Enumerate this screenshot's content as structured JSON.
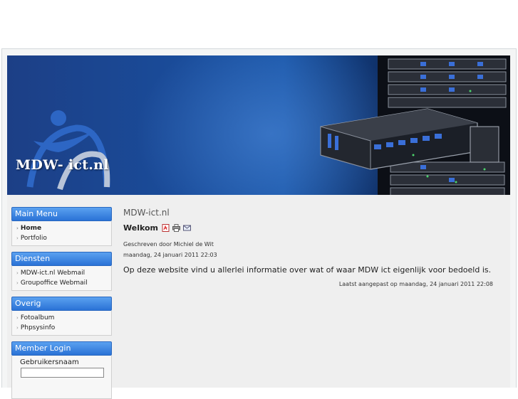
{
  "header": {
    "logo_text": "MDW- ict.nl"
  },
  "sidebar": {
    "main_menu": {
      "title": "Main Menu",
      "items": [
        {
          "label": "Home",
          "active": true
        },
        {
          "label": "Portfolio",
          "active": false
        }
      ]
    },
    "diensten": {
      "title": "Diensten",
      "items": [
        {
          "label": "MDW-ict.nl Webmail"
        },
        {
          "label": "Groupoffice Webmail"
        }
      ]
    },
    "overig": {
      "title": "Overig",
      "items": [
        {
          "label": "Fotoalbum"
        },
        {
          "label": "Phpsysinfo"
        }
      ]
    },
    "login": {
      "title": "Member Login",
      "username_label": "Gebruikersnaam",
      "username_value": ""
    }
  },
  "main": {
    "site_title": "MDW-ict.nl",
    "article": {
      "title": "Welkom",
      "author": "Geschreven door Michiel de Wit",
      "date": "maandag, 24 januari 2011 22:03",
      "intro": "Op deze website vind u allerlei informatie over wat of waar MDW ict eigenlijk voor bedoeld is.",
      "modified": "Laatst aangepast op maandag, 24 januari 2011 22:08"
    },
    "icons": [
      "pdf-icon",
      "print-icon",
      "email-icon"
    ]
  },
  "colors": {
    "module_header": "#3a86e2",
    "banner_blue": "#1a4c9a",
    "page_bg": "#efefef"
  }
}
